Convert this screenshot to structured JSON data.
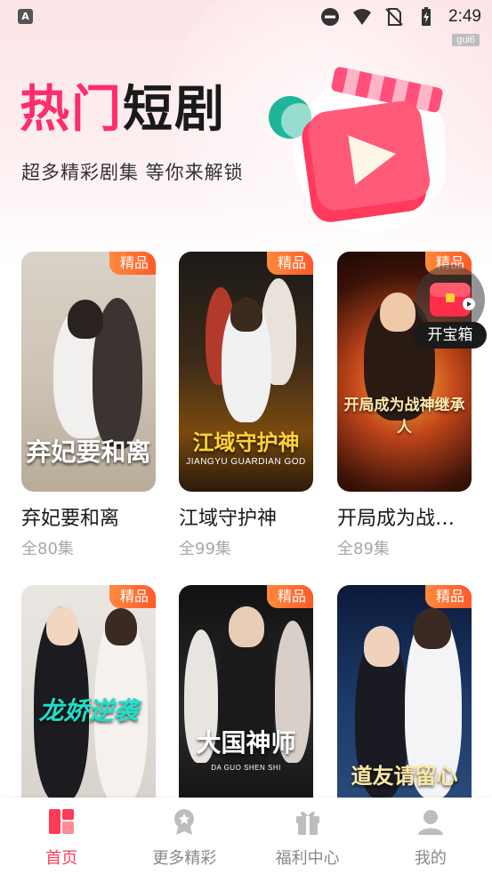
{
  "status_bar": {
    "app_icon": "A",
    "time": "2:49",
    "carrier": "gui6",
    "icons": [
      "dnd-icon",
      "wifi-icon",
      "no-sim-icon",
      "battery-charging-icon"
    ]
  },
  "hero": {
    "title_part1": "热门",
    "title_part2": "短剧",
    "subtitle": "超多精彩剧集 等你来解锁",
    "art_icon": "video-play-icon"
  },
  "badge_label": "精品",
  "dramas": [
    {
      "name": "弃妃要和离",
      "episodes": "全80集",
      "poster_title": "弃妃要和离",
      "poster_subtitle": ""
    },
    {
      "name": "江域守护神",
      "episodes": "全99集",
      "poster_title": "江域守护神",
      "poster_subtitle": "JIANGYU GUARDIAN GOD"
    },
    {
      "name": "开局成为战…",
      "episodes": "全89集",
      "poster_title": "开局成为战神继承人",
      "poster_subtitle": ""
    },
    {
      "name": "",
      "episodes": "",
      "poster_title": "龙娇逆袭",
      "poster_subtitle": ""
    },
    {
      "name": "",
      "episodes": "",
      "poster_title": "大国神师",
      "poster_subtitle": "DA GUO SHEN SHI"
    },
    {
      "name": "",
      "episodes": "",
      "poster_title": "道友请留心",
      "poster_subtitle": ""
    }
  ],
  "treasure": {
    "label": "开宝箱",
    "icon": "treasure-chest-icon"
  },
  "bottom_nav": [
    {
      "label": "首页",
      "icon": "home-grid-icon",
      "active": true
    },
    {
      "label": "更多精彩",
      "icon": "medal-icon",
      "active": false
    },
    {
      "label": "福利中心",
      "icon": "gift-icon",
      "active": false
    },
    {
      "label": "我的",
      "icon": "profile-icon",
      "active": false
    }
  ],
  "colors": {
    "accent": "#ff3b55",
    "title_pink": "#ff2d6a",
    "badge": "#ff6a2e"
  }
}
